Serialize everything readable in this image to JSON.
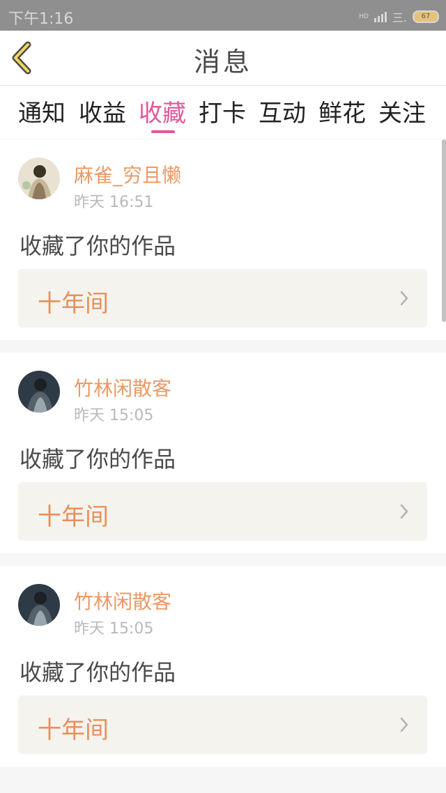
{
  "status_bar": {
    "time": "下午1:16",
    "network_label": "HD",
    "signal_label": "三.",
    "battery": "67"
  },
  "header": {
    "back_icon": "chevron-left-icon",
    "title": "消息"
  },
  "tabs": [
    {
      "label": "通知",
      "active": false
    },
    {
      "label": "收益",
      "active": false
    },
    {
      "label": "收藏",
      "active": true
    },
    {
      "label": "打卡",
      "active": false
    },
    {
      "label": "互动",
      "active": false
    },
    {
      "label": "鲜花",
      "active": false
    },
    {
      "label": "关注",
      "active": false
    }
  ],
  "accent_colors": {
    "active_tab": "#e15898",
    "username": "#ea9965",
    "work_title": "#ea8f58"
  },
  "messages": [
    {
      "user": "麻雀_穷且懒",
      "time": "昨天 16:51",
      "action": "收藏了你的作品",
      "work_title": "十年间"
    },
    {
      "user": "竹林闲散客",
      "time": "昨天 15:05",
      "action": "收藏了你的作品",
      "work_title": "十年间"
    },
    {
      "user": "竹林闲散客",
      "time": "昨天 15:05",
      "action": "收藏了你的作品",
      "work_title": "十年间"
    }
  ]
}
